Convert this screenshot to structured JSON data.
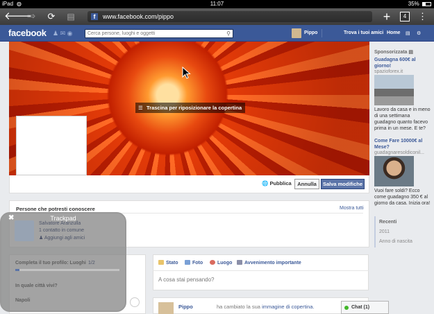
{
  "status_bar": {
    "device": "iPad",
    "time": "11:07",
    "battery": "35%",
    "battery_fraction": 0.35
  },
  "browser": {
    "url": "www.facebook.com/pippo",
    "tab_count": "4",
    "icons": [
      "back-arrow-icon",
      "forward-arrow-icon",
      "reload-icon",
      "tabs-overview-icon",
      "plus-icon",
      "tab-count-icon",
      "menu-dots-icon"
    ]
  },
  "fb_header": {
    "logo": "facebook",
    "search_placeholder": "Cerca persone, luoghi e oggetti",
    "user_name": "Pippo",
    "find_friends": "Trova i tuoi amici",
    "home": "Home"
  },
  "cover": {
    "reposition_text": "Trascina per riposizionare la copertina",
    "privacy_label": "Pubblica",
    "cancel_label": "Annulla",
    "save_label": "Salva modifiche"
  },
  "people": {
    "title": "Persone che potresti conoscere",
    "see_all": "Mostra tutti"
  },
  "trackpad": {
    "title": "Trackpad",
    "person_name": "Salvatore Aranzulla",
    "mutual": "1 contatto in comune",
    "add_friend": "Aggiungi agli amici",
    "profile_complete": "Completa il tuo profilo: Luoghi",
    "profile_step": "1/2",
    "profile_progress": 0.04,
    "city_question": "In quale città vivi?",
    "city_answer": "Napoli"
  },
  "composer": {
    "tabs": [
      "Stato",
      "Foto",
      "Luogo",
      "Avvenimento importante"
    ],
    "placeholder": "A cosa stai pensando?"
  },
  "story": {
    "name": "Pippo",
    "text_before": "ha cambiato la sua",
    "link": "immagine di copertina."
  },
  "sidebar": {
    "sponsored": "Sponsorizzata",
    "ads": [
      {
        "title": "Guadagna 600€ al giorno!",
        "domain": "spazioforex.it",
        "text": "Lavoro da casa e in meno di una settimana guadagno quanto facevo prima in un mese. E te?"
      },
      {
        "title": "Come Fare 10000€ al Mese?",
        "domain": "guadagnaresoldiconil...",
        "text": "Vuoi fare soldi? Ecco come guadagno 350 € al giorno da casa. Inizia ora!"
      }
    ],
    "recent_title": "Recenti",
    "recent_items": [
      "2011",
      "Anno di nascita"
    ]
  },
  "chat": {
    "label": "Chat (1)"
  }
}
